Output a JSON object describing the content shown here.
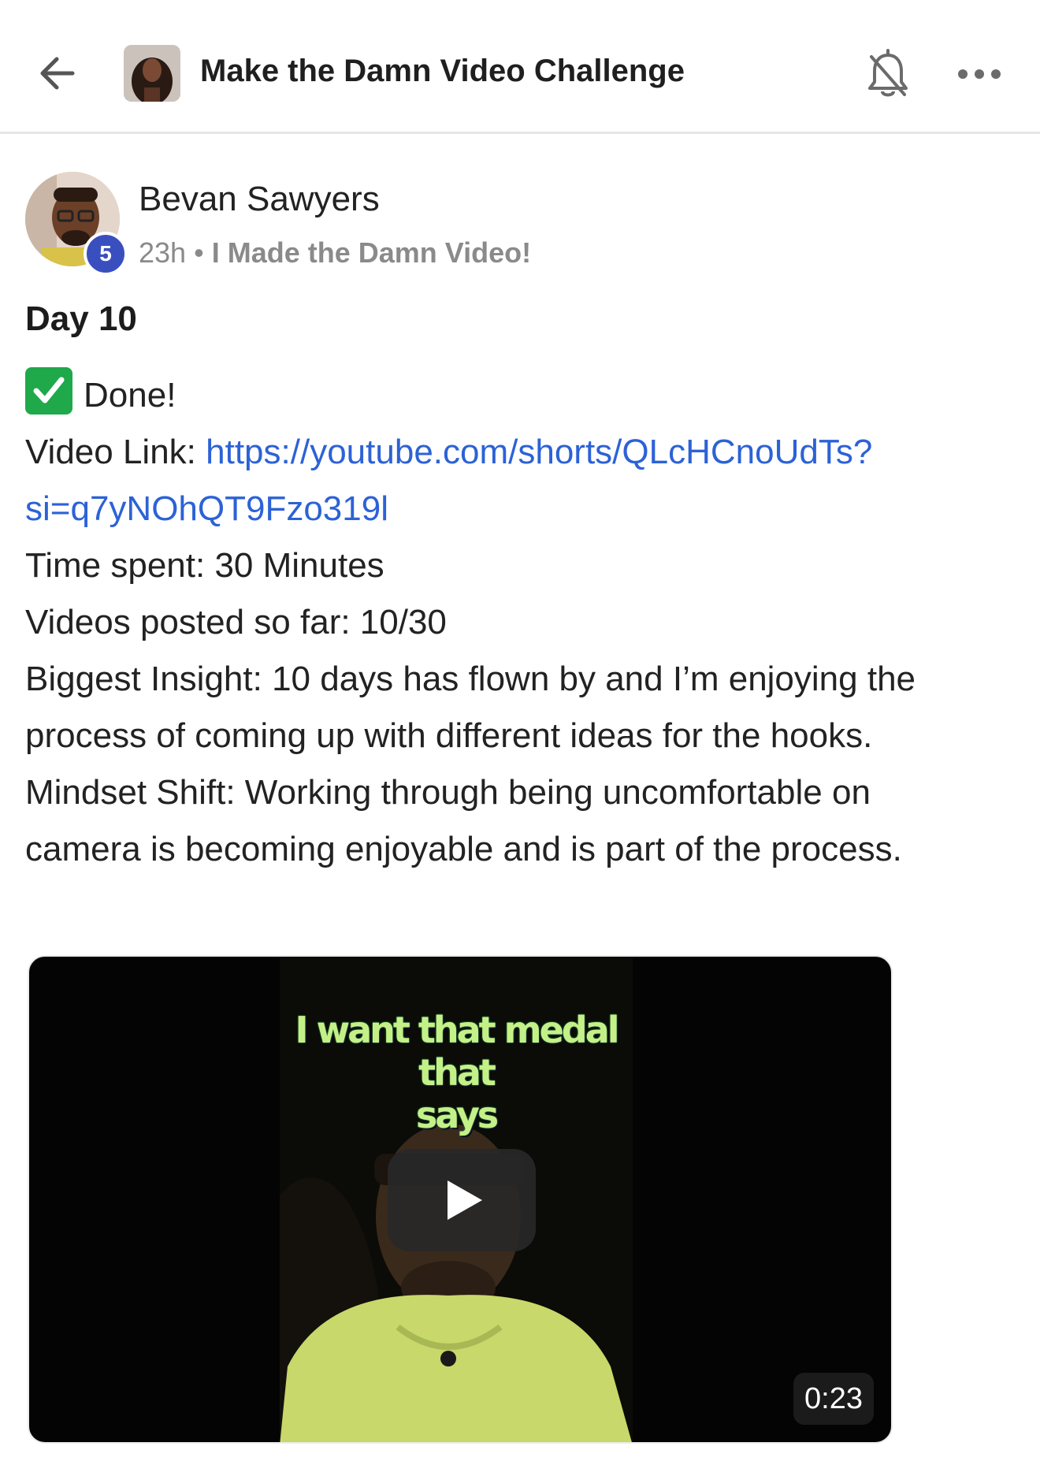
{
  "header": {
    "title": "Make the Damn Video Challenge",
    "icons": [
      "back-arrow-icon",
      "group-avatar",
      "bell-off-icon",
      "more-icon"
    ]
  },
  "post": {
    "author": "Bevan Sawyers",
    "level": "5",
    "time": "23h",
    "separator": "•",
    "category": "I Made the Damn Video!",
    "title": "Day 10",
    "lines": {
      "done": "Done!",
      "video_link_label": "Video Link: ",
      "video_link_part1": "https://youtube.com/shorts/QLcHCnoUdTs?",
      "video_link_part2": "si=q7yNOhQT9Fzo319l",
      "time_spent": "Time spent: 30 Minutes",
      "videos_posted": "Videos posted so far: 10/30",
      "insight_1": "Biggest Insight: 10 days has flown by and I’m enjoying the",
      "insight_2": "process of coming up with different ideas for the hooks.",
      "mindset_1": "Mindset Shift: Working through being uncomfortable on",
      "mindset_2": "camera is becoming enjoyable and is part of the process."
    }
  },
  "video": {
    "caption_1": "I want that medal that",
    "caption_2": "says",
    "duration": "0:23"
  },
  "colors": {
    "link": "#2c62d6",
    "badge": "#3a4fbf",
    "check": "#1fa94a",
    "meta": "#8a8a8a"
  }
}
